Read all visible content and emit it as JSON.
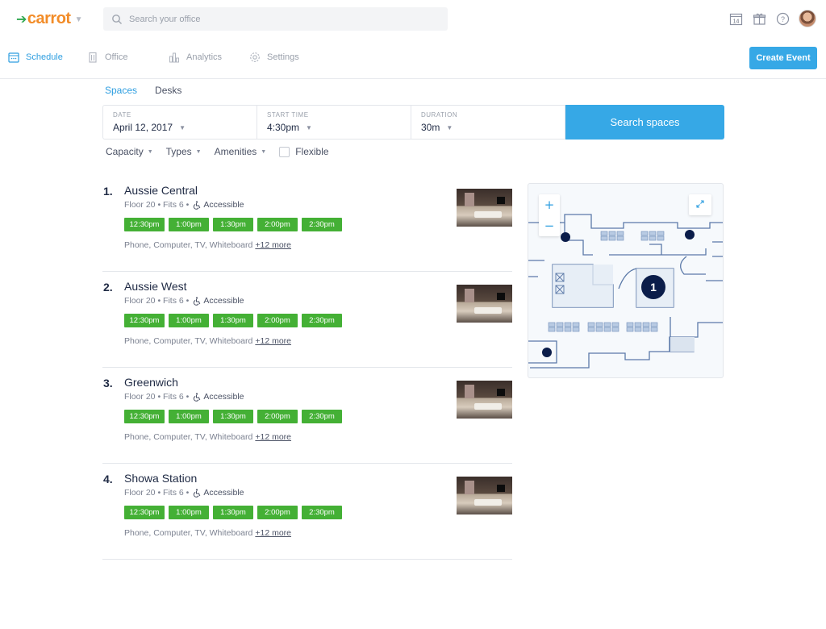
{
  "header": {
    "logo_text": "carrot",
    "search_placeholder": "Search your office",
    "calendar_day": "14"
  },
  "nav": {
    "items": [
      {
        "label": "Schedule",
        "icon": "calendar-icon",
        "active": true
      },
      {
        "label": "Office",
        "icon": "building-icon",
        "active": false
      },
      {
        "label": "Analytics",
        "icon": "bar-chart-icon",
        "active": false
      },
      {
        "label": "Settings",
        "icon": "gear-icon",
        "active": false
      }
    ],
    "create_label": "Create Event"
  },
  "tabs": [
    {
      "label": "Spaces",
      "active": true
    },
    {
      "label": "Desks",
      "active": false
    }
  ],
  "searchbar": {
    "date_label": "DATE",
    "date_value": "April 12, 2017",
    "start_label": "START TIME",
    "start_value": "4:30pm",
    "duration_label": "DURATION",
    "duration_value": "30m",
    "button_label": "Search spaces"
  },
  "filters": {
    "capacity": "Capacity",
    "types": "Types",
    "amenities": "Amenities",
    "flexible": "Flexible"
  },
  "rooms": [
    {
      "num": "1.",
      "name": "Aussie Central",
      "floor": "Floor 20",
      "fits": "Fits 6",
      "accessible": "Accessible",
      "slots": [
        "12:30pm",
        "1:00pm",
        "1:30pm",
        "2:00pm",
        "2:30pm"
      ],
      "amenities": "Phone, Computer, TV, Whiteboard",
      "more": "+12 more"
    },
    {
      "num": "2.",
      "name": "Aussie West",
      "floor": "Floor 20",
      "fits": "Fits 6",
      "accessible": "Accessible",
      "slots": [
        "12:30pm",
        "1:00pm",
        "1:30pm",
        "2:00pm",
        "2:30pm"
      ],
      "amenities": "Phone, Computer, TV, Whiteboard",
      "more": "+12 more"
    },
    {
      "num": "3.",
      "name": "Greenwich",
      "floor": "Floor 20",
      "fits": "Fits 6",
      "accessible": "Accessible",
      "slots": [
        "12:30pm",
        "1:00pm",
        "1:30pm",
        "2:00pm",
        "2:30pm"
      ],
      "amenities": "Phone, Computer, TV, Whiteboard",
      "more": "+12 more"
    },
    {
      "num": "4.",
      "name": "Showa Station",
      "floor": "Floor 20",
      "fits": "Fits 6",
      "accessible": "Accessible",
      "slots": [
        "12:30pm",
        "1:00pm",
        "1:30pm",
        "2:00pm",
        "2:30pm"
      ],
      "amenities": "Phone, Computer, TV, Whiteboard",
      "more": "+12 more"
    }
  ],
  "map": {
    "zoom_in": "+",
    "zoom_out": "−",
    "selected_pin_label": "1"
  },
  "colors": {
    "accent": "#36a8e6",
    "slot_green": "#44b035",
    "logo_orange": "#f28c28",
    "logo_green": "#2fa84f",
    "pin_navy": "#0b1d4a"
  }
}
